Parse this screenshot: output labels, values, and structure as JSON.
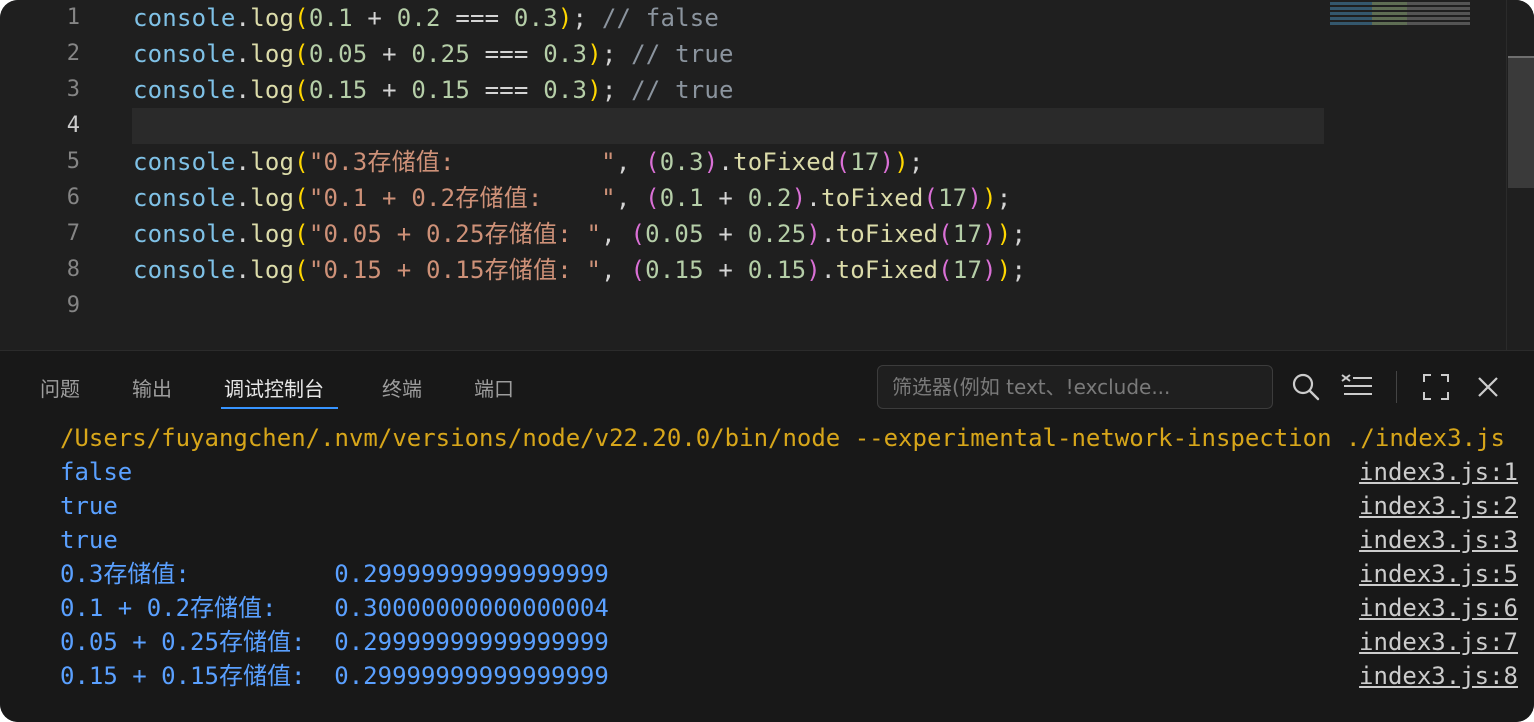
{
  "editor": {
    "lines": [
      {
        "n": "1",
        "tokens": [
          [
            "obj",
            "console"
          ],
          [
            "plain",
            "."
          ],
          [
            "fn",
            "log"
          ],
          [
            "paren1",
            "("
          ],
          [
            "num",
            "0.1"
          ],
          [
            "plain",
            " + "
          ],
          [
            "num",
            "0.2"
          ],
          [
            "plain",
            " === "
          ],
          [
            "num",
            "0.3"
          ],
          [
            "paren1",
            ")"
          ],
          [
            "plain",
            "; "
          ],
          [
            "comment",
            "// false"
          ]
        ]
      },
      {
        "n": "2",
        "tokens": [
          [
            "obj",
            "console"
          ],
          [
            "plain",
            "."
          ],
          [
            "fn",
            "log"
          ],
          [
            "paren1",
            "("
          ],
          [
            "num",
            "0.05"
          ],
          [
            "plain",
            " + "
          ],
          [
            "num",
            "0.25"
          ],
          [
            "plain",
            " === "
          ],
          [
            "num",
            "0.3"
          ],
          [
            "paren1",
            ")"
          ],
          [
            "plain",
            "; "
          ],
          [
            "comment",
            "// true"
          ]
        ]
      },
      {
        "n": "3",
        "tokens": [
          [
            "obj",
            "console"
          ],
          [
            "plain",
            "."
          ],
          [
            "fn",
            "log"
          ],
          [
            "paren1",
            "("
          ],
          [
            "num",
            "0.15"
          ],
          [
            "plain",
            " + "
          ],
          [
            "num",
            "0.15"
          ],
          [
            "plain",
            " === "
          ],
          [
            "num",
            "0.3"
          ],
          [
            "paren1",
            ")"
          ],
          [
            "plain",
            "; "
          ],
          [
            "comment",
            "// true"
          ]
        ]
      },
      {
        "n": "4",
        "tokens": []
      },
      {
        "n": "5",
        "tokens": [
          [
            "obj",
            "console"
          ],
          [
            "plain",
            "."
          ],
          [
            "fn",
            "log"
          ],
          [
            "paren1",
            "("
          ],
          [
            "str",
            "\"0.3存储值:          \""
          ],
          [
            "plain",
            ", "
          ],
          [
            "paren2",
            "("
          ],
          [
            "num",
            "0.3"
          ],
          [
            "paren2",
            ")"
          ],
          [
            "plain",
            "."
          ],
          [
            "fn",
            "toFixed"
          ],
          [
            "paren2",
            "("
          ],
          [
            "num",
            "17"
          ],
          [
            "paren2",
            ")"
          ],
          [
            "paren1",
            ")"
          ],
          [
            "plain",
            ";"
          ]
        ]
      },
      {
        "n": "6",
        "tokens": [
          [
            "obj",
            "console"
          ],
          [
            "plain",
            "."
          ],
          [
            "fn",
            "log"
          ],
          [
            "paren1",
            "("
          ],
          [
            "str",
            "\"0.1 + 0.2存储值:    \""
          ],
          [
            "plain",
            ", "
          ],
          [
            "paren2",
            "("
          ],
          [
            "num",
            "0.1"
          ],
          [
            "plain",
            " + "
          ],
          [
            "num",
            "0.2"
          ],
          [
            "paren2",
            ")"
          ],
          [
            "plain",
            "."
          ],
          [
            "fn",
            "toFixed"
          ],
          [
            "paren2",
            "("
          ],
          [
            "num",
            "17"
          ],
          [
            "paren2",
            ")"
          ],
          [
            "paren1",
            ")"
          ],
          [
            "plain",
            ";"
          ]
        ]
      },
      {
        "n": "7",
        "tokens": [
          [
            "obj",
            "console"
          ],
          [
            "plain",
            "."
          ],
          [
            "fn",
            "log"
          ],
          [
            "paren1",
            "("
          ],
          [
            "str",
            "\"0.05 + 0.25存储值: \""
          ],
          [
            "plain",
            ", "
          ],
          [
            "paren2",
            "("
          ],
          [
            "num",
            "0.05"
          ],
          [
            "plain",
            " + "
          ],
          [
            "num",
            "0.25"
          ],
          [
            "paren2",
            ")"
          ],
          [
            "plain",
            "."
          ],
          [
            "fn",
            "toFixed"
          ],
          [
            "paren2",
            "("
          ],
          [
            "num",
            "17"
          ],
          [
            "paren2",
            ")"
          ],
          [
            "paren1",
            ")"
          ],
          [
            "plain",
            ";"
          ]
        ]
      },
      {
        "n": "8",
        "tokens": [
          [
            "obj",
            "console"
          ],
          [
            "plain",
            "."
          ],
          [
            "fn",
            "log"
          ],
          [
            "paren1",
            "("
          ],
          [
            "str",
            "\"0.15 + 0.15存储值: \""
          ],
          [
            "plain",
            ", "
          ],
          [
            "paren2",
            "("
          ],
          [
            "num",
            "0.15"
          ],
          [
            "plain",
            " + "
          ],
          [
            "num",
            "0.15"
          ],
          [
            "paren2",
            ")"
          ],
          [
            "plain",
            "."
          ],
          [
            "fn",
            "toFixed"
          ],
          [
            "paren2",
            "("
          ],
          [
            "num",
            "17"
          ],
          [
            "paren2",
            ")"
          ],
          [
            "paren1",
            ")"
          ],
          [
            "plain",
            ";"
          ]
        ]
      },
      {
        "n": "9",
        "tokens": []
      }
    ],
    "active_line": "4"
  },
  "panel": {
    "tabs": [
      "问题",
      "输出",
      "调试控制台",
      "终端",
      "端口"
    ],
    "active_tab": "调试控制台",
    "filter_placeholder": "筛选器(例如 text、!exclude...",
    "icons": [
      "search-icon",
      "clear-filter-icon",
      "maximize-icon",
      "close-icon"
    ]
  },
  "console": {
    "command": "/Users/fuyangchen/.nvm/versions/node/v22.20.0/bin/node --experimental-network-inspection ./index3.js",
    "rows": [
      {
        "text": "false",
        "source": "index3.js:1"
      },
      {
        "text": "true",
        "source": "index3.js:2"
      },
      {
        "text": "true",
        "source": "index3.js:3"
      },
      {
        "text": "0.3存储值:          0.29999999999999999",
        "source": "index3.js:5"
      },
      {
        "text": "0.1 + 0.2存储值:    0.30000000000000004",
        "source": "index3.js:6"
      },
      {
        "text": "0.05 + 0.25存储值:  0.29999999999999999",
        "source": "index3.js:7"
      },
      {
        "text": "0.15 + 0.15存储值:  0.29999999999999999",
        "source": "index3.js:8"
      }
    ]
  }
}
